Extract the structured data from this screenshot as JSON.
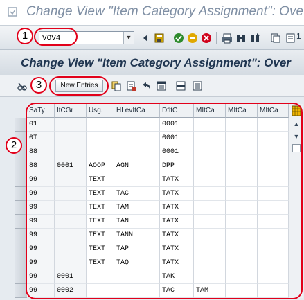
{
  "window": {
    "title": "Change View \"Item Category Assignment\": Ove"
  },
  "toolbar": {
    "command_field_value": "VOV4"
  },
  "screen": {
    "title": "Change View \"Item Category Assignment\": Over",
    "new_entries_label": "New Entries"
  },
  "table": {
    "columns": [
      "SaTy",
      "ItCGr",
      "Usg.",
      "HLevItCa",
      "DfltC",
      "MItCa",
      "MItCa",
      "MItCa"
    ],
    "rows": [
      [
        "01",
        "",
        "",
        "",
        "0001",
        "",
        "",
        ""
      ],
      [
        "0T",
        "",
        "",
        "",
        "0001",
        "",
        "",
        ""
      ],
      [
        "88",
        "",
        "",
        "",
        "0001",
        "",
        "",
        ""
      ],
      [
        "88",
        "0001",
        "AOOP",
        "AGN",
        "DPP",
        "",
        "",
        ""
      ],
      [
        "99",
        "",
        "TEXT",
        "",
        "TATX",
        "",
        "",
        ""
      ],
      [
        "99",
        "",
        "TEXT",
        "TAC",
        "TATX",
        "",
        "",
        ""
      ],
      [
        "99",
        "",
        "TEXT",
        "TAM",
        "TATX",
        "",
        "",
        ""
      ],
      [
        "99",
        "",
        "TEXT",
        "TAN",
        "TATX",
        "",
        "",
        ""
      ],
      [
        "99",
        "",
        "TEXT",
        "TANN",
        "TATX",
        "",
        "",
        ""
      ],
      [
        "99",
        "",
        "TEXT",
        "TAP",
        "TATX",
        "",
        "",
        ""
      ],
      [
        "99",
        "",
        "TEXT",
        "TAQ",
        "TATX",
        "",
        "",
        ""
      ],
      [
        "99",
        "0001",
        "",
        "",
        "TAK",
        "",
        "",
        ""
      ],
      [
        "99",
        "0002",
        "",
        "",
        "TAC",
        "TAM",
        "",
        ""
      ]
    ]
  },
  "callouts": [
    "1",
    "2",
    "3"
  ],
  "colors": {
    "callout": "#e2001a",
    "title_text": "#7f8fa4",
    "header_text": "#1f3550"
  },
  "icons": [
    "document-icon",
    "back-icon",
    "save-icon",
    "green-check-icon",
    "exit-icon",
    "cancel-icon",
    "print-icon",
    "find-icon",
    "find-next-icon",
    "create-session-icon",
    "display-change-icon",
    "copy-as-icon",
    "delete-icon",
    "undo-icon",
    "select-all-icon",
    "select-block-icon",
    "deselect-all-icon",
    "table-settings-icon"
  ]
}
